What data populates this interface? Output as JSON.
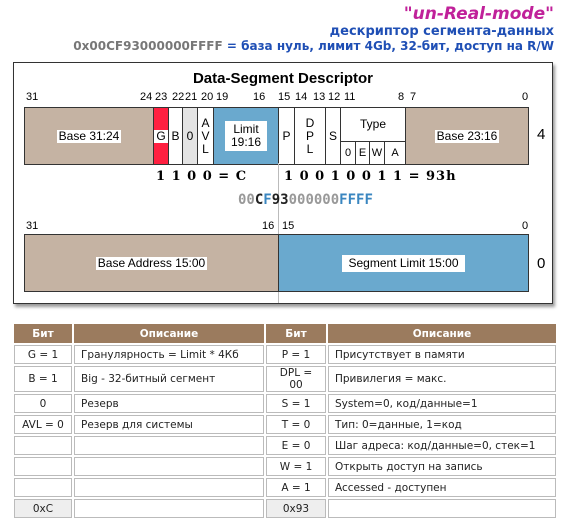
{
  "header": {
    "title": "\"un-Real-mode\"",
    "subtitle": "дескриптор сегмента-данных",
    "hex": "0x00CF93000000FFFF",
    "desc": " = база нуль, лимит 4Gb, 32-бит, доступ на R/W"
  },
  "diagram": {
    "title": "Data-Segment Descriptor",
    "upper_bits": [
      "31",
      "24",
      "23",
      "22",
      "21",
      "20",
      "19",
      "16",
      "15",
      "14",
      "13",
      "12",
      "11",
      "8",
      "7",
      "0"
    ],
    "upper_fields": {
      "base_hi": "Base 31:24",
      "g": "G",
      "b": "B",
      "zero": "0",
      "avl": [
        "A",
        "V",
        "L"
      ],
      "limit": [
        "Limit",
        "19:16"
      ],
      "p": "P",
      "dpl": [
        "D",
        "P",
        "L"
      ],
      "s": "S",
      "type": "Type",
      "type_bits": [
        "0",
        "E",
        "W",
        "A"
      ],
      "base_mid": "Base 23:16"
    },
    "upper_offset": "4",
    "bits_left": "1 1 0 0 = C",
    "bits_right": "1 0 0 1 0 0 1 1 = 93h",
    "hex_parts": [
      {
        "t": "00",
        "c": "#999"
      },
      {
        "t": "C",
        "c": "#222"
      },
      {
        "t": "F",
        "c": "#3a86c0"
      },
      {
        "t": "93",
        "c": "#222"
      },
      {
        "t": "000000",
        "c": "#999"
      },
      {
        "t": "FFFF",
        "c": "#3a86c0"
      }
    ],
    "lower_bits": [
      "31",
      "16",
      "15",
      "0"
    ],
    "lower_fields": {
      "base": "Base Address 15:00",
      "limit": "Segment Limit 15:00"
    },
    "lower_offset": "0",
    "colors": {
      "base": "#c5b3a3",
      "limit": "#6aa9ce",
      "g": "#ff2040"
    }
  },
  "table": {
    "headers": [
      "Бит",
      "Описание",
      "Бит",
      "Описание"
    ],
    "rows": [
      [
        "G = 1",
        "Гранулярность = Limit * 4Кб",
        "P = 1",
        "Присутствует в памяти"
      ],
      [
        "B = 1",
        "Big - 32-битный сегмент",
        "DPL = 00",
        "Привилегия = макс."
      ],
      [
        "0",
        "Резерв",
        "S = 1",
        "System=0, код/данные=1"
      ],
      [
        "AVL = 0",
        "Резерв для системы",
        "T = 0",
        "Тип: 0=данные, 1=код"
      ],
      [
        "",
        "",
        "E = 0",
        "Шаг адреса: код/данные=0, стек=1"
      ],
      [
        "",
        "",
        "W = 1",
        "Открыть доступ на запись"
      ],
      [
        "",
        "",
        "A = 1",
        "Accessed - доступен"
      ],
      [
        "0xC",
        "",
        "0x93",
        ""
      ]
    ]
  }
}
